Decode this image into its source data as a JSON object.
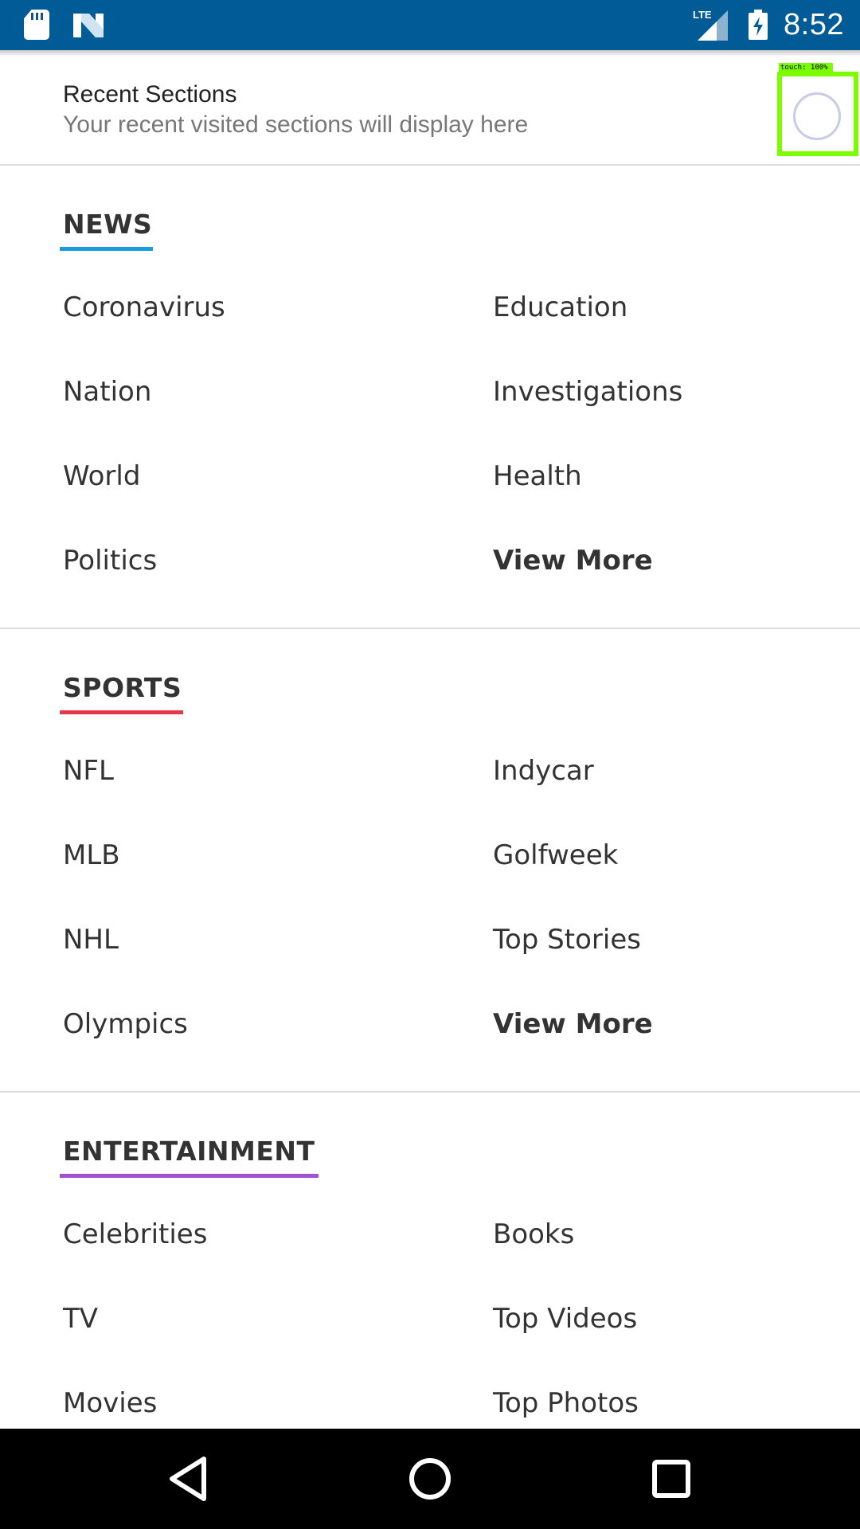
{
  "status_bar": {
    "time": "8:52",
    "network": "LTE",
    "icons": [
      "sd-card-icon",
      "n-app-icon",
      "lte-signal-icon",
      "battery-charging-icon"
    ]
  },
  "recent": {
    "title": "Recent Sections",
    "subtitle": "Your recent visited sections will display here"
  },
  "touch_overlay": {
    "label": "touch: 100%"
  },
  "sections": {
    "news": {
      "title": "NEWS",
      "accent": "#1a9de0",
      "left": [
        "Coronavirus",
        "Nation",
        "World",
        "Politics"
      ],
      "right": [
        "Education",
        "Investigations",
        "Health",
        "View More"
      ]
    },
    "sports": {
      "title": "SPORTS",
      "accent": "#e8344c",
      "left": [
        "NFL",
        "MLB",
        "NHL",
        "Olympics"
      ],
      "right": [
        "Indycar",
        "Golfweek",
        "Top Stories",
        "View More"
      ]
    },
    "entertainment": {
      "title": "ENTERTAINMENT",
      "accent": "#a54fd6",
      "left": [
        "Celebrities",
        "TV",
        "Movies"
      ],
      "right": [
        "Books",
        "Top Videos",
        "Top Photos"
      ]
    }
  },
  "nav_bar": {
    "buttons": [
      "back-icon",
      "home-icon",
      "recents-icon"
    ]
  }
}
